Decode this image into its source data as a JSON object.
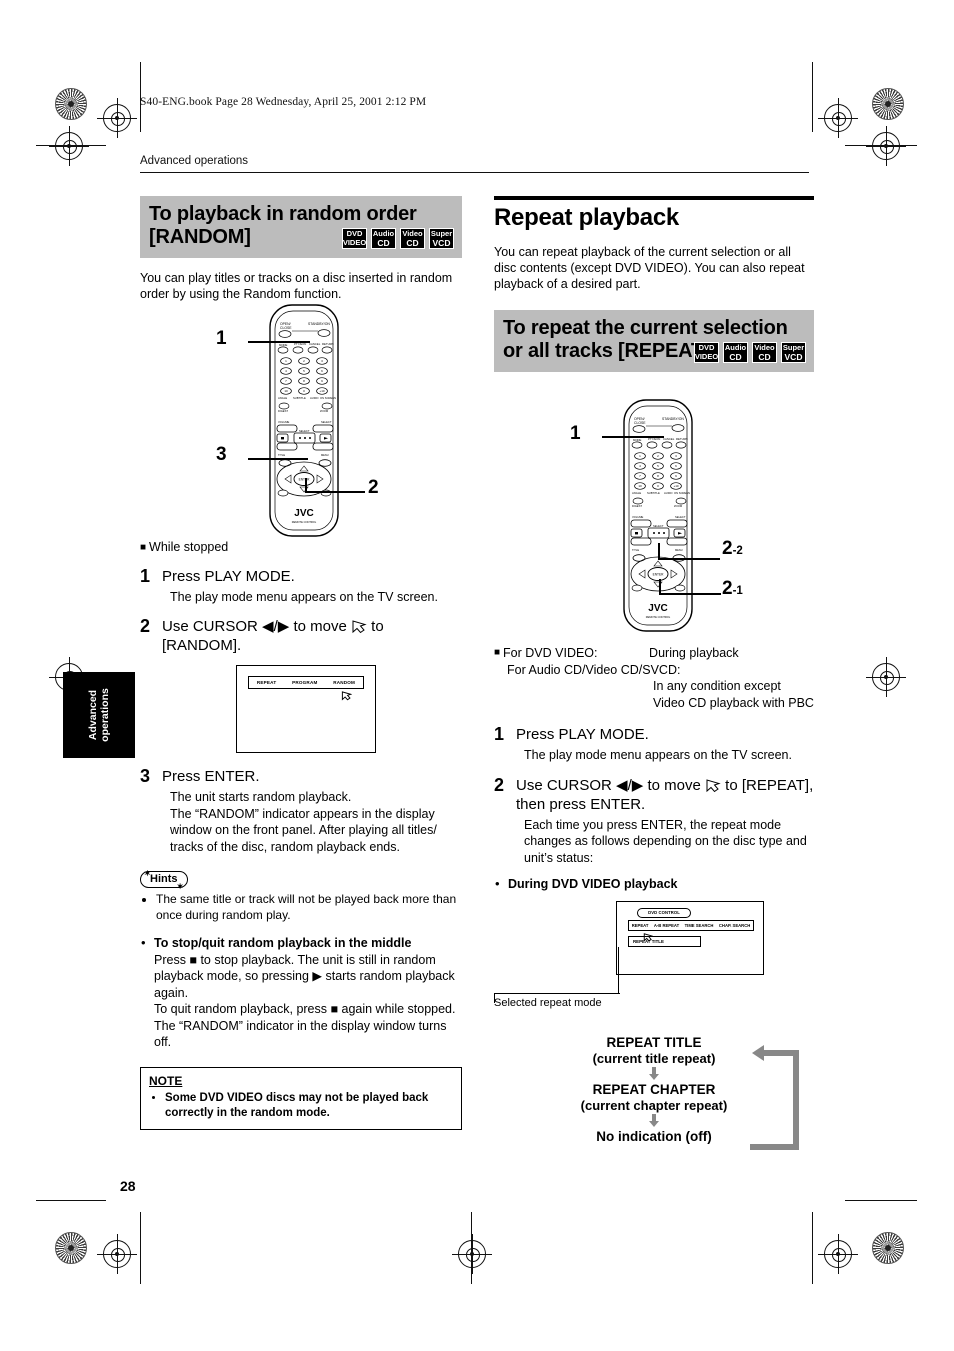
{
  "page": {
    "file_header": "S40-ENG.book  Page 28  Wednesday, April 25, 2001  2:12 PM",
    "breadcrumb": "Advanced operations",
    "side_tab": "Advanced operations",
    "page_number": "28"
  },
  "disc_badges": [
    {
      "line1": "DVD",
      "line2": "VIDEO"
    },
    {
      "line1": "Audio",
      "line2": "CD"
    },
    {
      "line1": "Video",
      "line2": "CD"
    },
    {
      "line1": "Super",
      "line2": "VCD"
    }
  ],
  "left": {
    "heading": "To playback  in random order [RANDOM]",
    "intro": "You can play titles or tracks on a disc inserted in random order by using the Random function.",
    "remote_callouts": [
      "1",
      "3",
      "2"
    ],
    "condition": "While stopped",
    "steps": [
      {
        "number": "1",
        "title": "Press PLAY MODE.",
        "detail": "The play mode menu appears on the TV screen."
      },
      {
        "number": "2",
        "title_a": "Use CURSOR",
        "title_arrows": "◀/▶",
        "title_b": "to move",
        "title_c": "to [RANDOM].",
        "detail": ""
      },
      {
        "number": "3",
        "title": "Press ENTER.",
        "detail": "The unit starts random playback.\nThe “RANDOM” indicator appears in the display window on the front panel. After playing all titles/ tracks of the disc, random playback ends."
      }
    ],
    "tv_menu": {
      "items": [
        "REPEAT",
        "PROGRAM",
        "RANDOM"
      ],
      "cursor_on": "RANDOM"
    },
    "hints_label": "Hints",
    "hints": [
      "The same title or track will not be played back more than once during random play."
    ],
    "stop_quit": {
      "heading": "To stop/quit random playback in the middle",
      "body": "Press ■ to stop playback. The unit is still in random playback mode, so pressing ▶ starts random playback again.\nTo quit random playback, press ■ again while stopped.  The “RANDOM” indicator in the display window turns off."
    },
    "note": {
      "label": "NOTE",
      "items": [
        "Some DVD VIDEO discs may not be played back correctly in the random mode."
      ]
    }
  },
  "right": {
    "section_title": "Repeat playback",
    "section_intro": "You can repeat playback of the current selection or all disc contents (except DVD VIDEO). You can also repeat playback of a desired part.",
    "heading": "To repeat the current selection or all tracks [REPEAT]",
    "remote_callouts": [
      "1",
      "2-2",
      "2-1"
    ],
    "conditions": [
      {
        "label": "For DVD VIDEO:",
        "value": "During playback"
      },
      {
        "label": "For Audio CD/Video CD/SVCD:",
        "value": "In any condition except Video CD playback with PBC"
      }
    ],
    "steps": [
      {
        "number": "1",
        "title": "Press PLAY MODE.",
        "detail": "The play mode menu appears on the TV screen."
      },
      {
        "number": "2",
        "title_a": "Use CURSOR",
        "title_arrows": "◀/▶",
        "title_b": "to move",
        "title_c": "to [REPEAT], then press ENTER.",
        "detail": "Each time you press ENTER, the repeat mode changes as follows depending on the disc type and unit’s status:"
      }
    ],
    "during_dvd_heading": "During DVD VIDEO playback",
    "ctrl_menu": {
      "pill": "DVD CONTROL",
      "items": [
        "REPEAT",
        "A-B REPEAT",
        "TIME SEARCH",
        "CHAP. SEARCH"
      ],
      "selected": "REPEAT  TITLE",
      "caption": "Selected repeat mode"
    },
    "repeat_flow": [
      {
        "main": "REPEAT TITLE",
        "sub": "(current title repeat)"
      },
      {
        "main": "REPEAT CHAPTER",
        "sub": "(current chapter repeat)"
      },
      {
        "main": "No indication (off)",
        "sub": ""
      }
    ]
  }
}
